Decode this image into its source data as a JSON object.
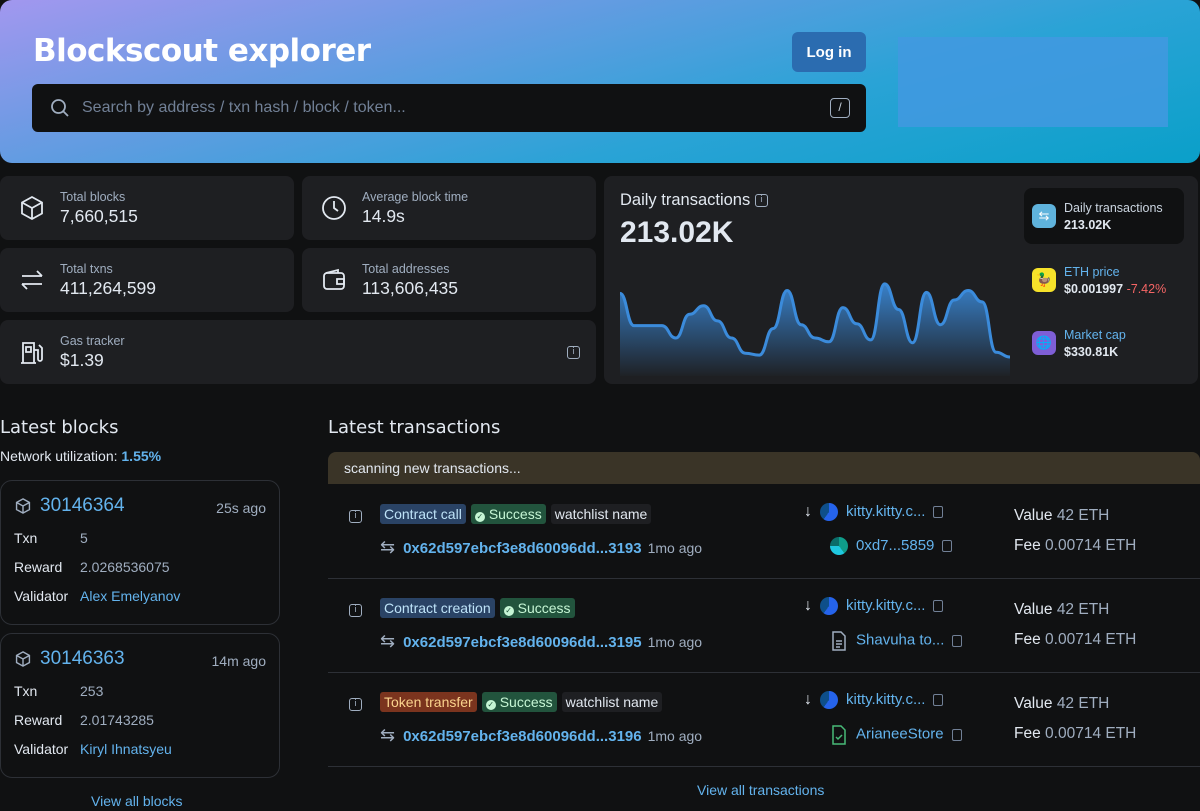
{
  "header": {
    "title": "Blockscout explorer",
    "search_placeholder": "Search by address / txn hash / block / token...",
    "slash_hint": "/",
    "login": "Log in"
  },
  "stats": [
    {
      "label": "Total blocks",
      "value": "7,660,515",
      "icon": "cube-icon"
    },
    {
      "label": "Average block time",
      "value": "14.9s",
      "icon": "clock-icon"
    },
    {
      "label": "Total txns",
      "value": "411,264,599",
      "icon": "transfer-icon"
    },
    {
      "label": "Total addresses",
      "value": "113,606,435",
      "icon": "wallet-icon"
    },
    {
      "label": "Gas tracker",
      "value": "$1.39",
      "icon": "gas-icon"
    }
  ],
  "chart_panel": {
    "title": "Daily transactions",
    "value": "213.02K",
    "side": [
      {
        "label": "Daily transactions",
        "value": "213.02K"
      },
      {
        "label": "ETH price",
        "value": "$0.001997",
        "change": "-7.42%"
      },
      {
        "label": "Market cap",
        "value": "$330.81K"
      }
    ]
  },
  "chart_data": {
    "type": "area",
    "title": "Daily transactions",
    "values": [
      87,
      53,
      53,
      53,
      40,
      65,
      74,
      58,
      40,
      24,
      22,
      50,
      90,
      54,
      40,
      36,
      72,
      55,
      38,
      97,
      70,
      35,
      88,
      54,
      80,
      90,
      78,
      25,
      20
    ],
    "color": "#3b8bdb"
  },
  "latest_blocks": {
    "title": "Latest blocks",
    "utilization_label": "Network utilization:",
    "utilization_value": "1.55%",
    "blocks": [
      {
        "number": "30146364",
        "ago": "25s ago",
        "txn": "5",
        "reward": "2.0268536075",
        "validator": "Alex Emelyanov"
      },
      {
        "number": "30146363",
        "ago": "14m ago",
        "txn": "253",
        "reward": "2.01743285",
        "validator": "Kiryl Ihnatsyeu"
      }
    ],
    "labels": {
      "txn": "Txn",
      "reward": "Reward",
      "validator": "Validator"
    },
    "view_all": "View all blocks"
  },
  "latest_txs": {
    "title": "Latest transactions",
    "scanning": "scanning new transactions...",
    "txs": [
      {
        "type": "Contract call",
        "status": "Success",
        "watch": "watchlist name",
        "hash": "0x62d597ebcf3e8d60096dd...3193",
        "ago": "1mo ago",
        "from": "kitty.kitty.c...",
        "to": "0xd7...5859",
        "value": "42 ETH",
        "fee": "0.00714 ETH"
      },
      {
        "type": "Contract creation",
        "status": "Success",
        "watch": "",
        "hash": "0x62d597ebcf3e8d60096dd...3195",
        "ago": "1mo ago",
        "from": "kitty.kitty.c...",
        "to": "Shavuha to...",
        "value": "42 ETH",
        "fee": "0.00714 ETH"
      },
      {
        "type": "Token transfer",
        "status": "Success",
        "watch": "watchlist name",
        "hash": "0x62d597ebcf3e8d60096dd...3196",
        "ago": "1mo ago",
        "from": "kitty.kitty.c...",
        "to": "ArianeeStore",
        "value": "42 ETH",
        "fee": "0.00714 ETH"
      }
    ],
    "value_label": "Value",
    "fee_label": "Fee",
    "view_all": "View all transactions"
  }
}
